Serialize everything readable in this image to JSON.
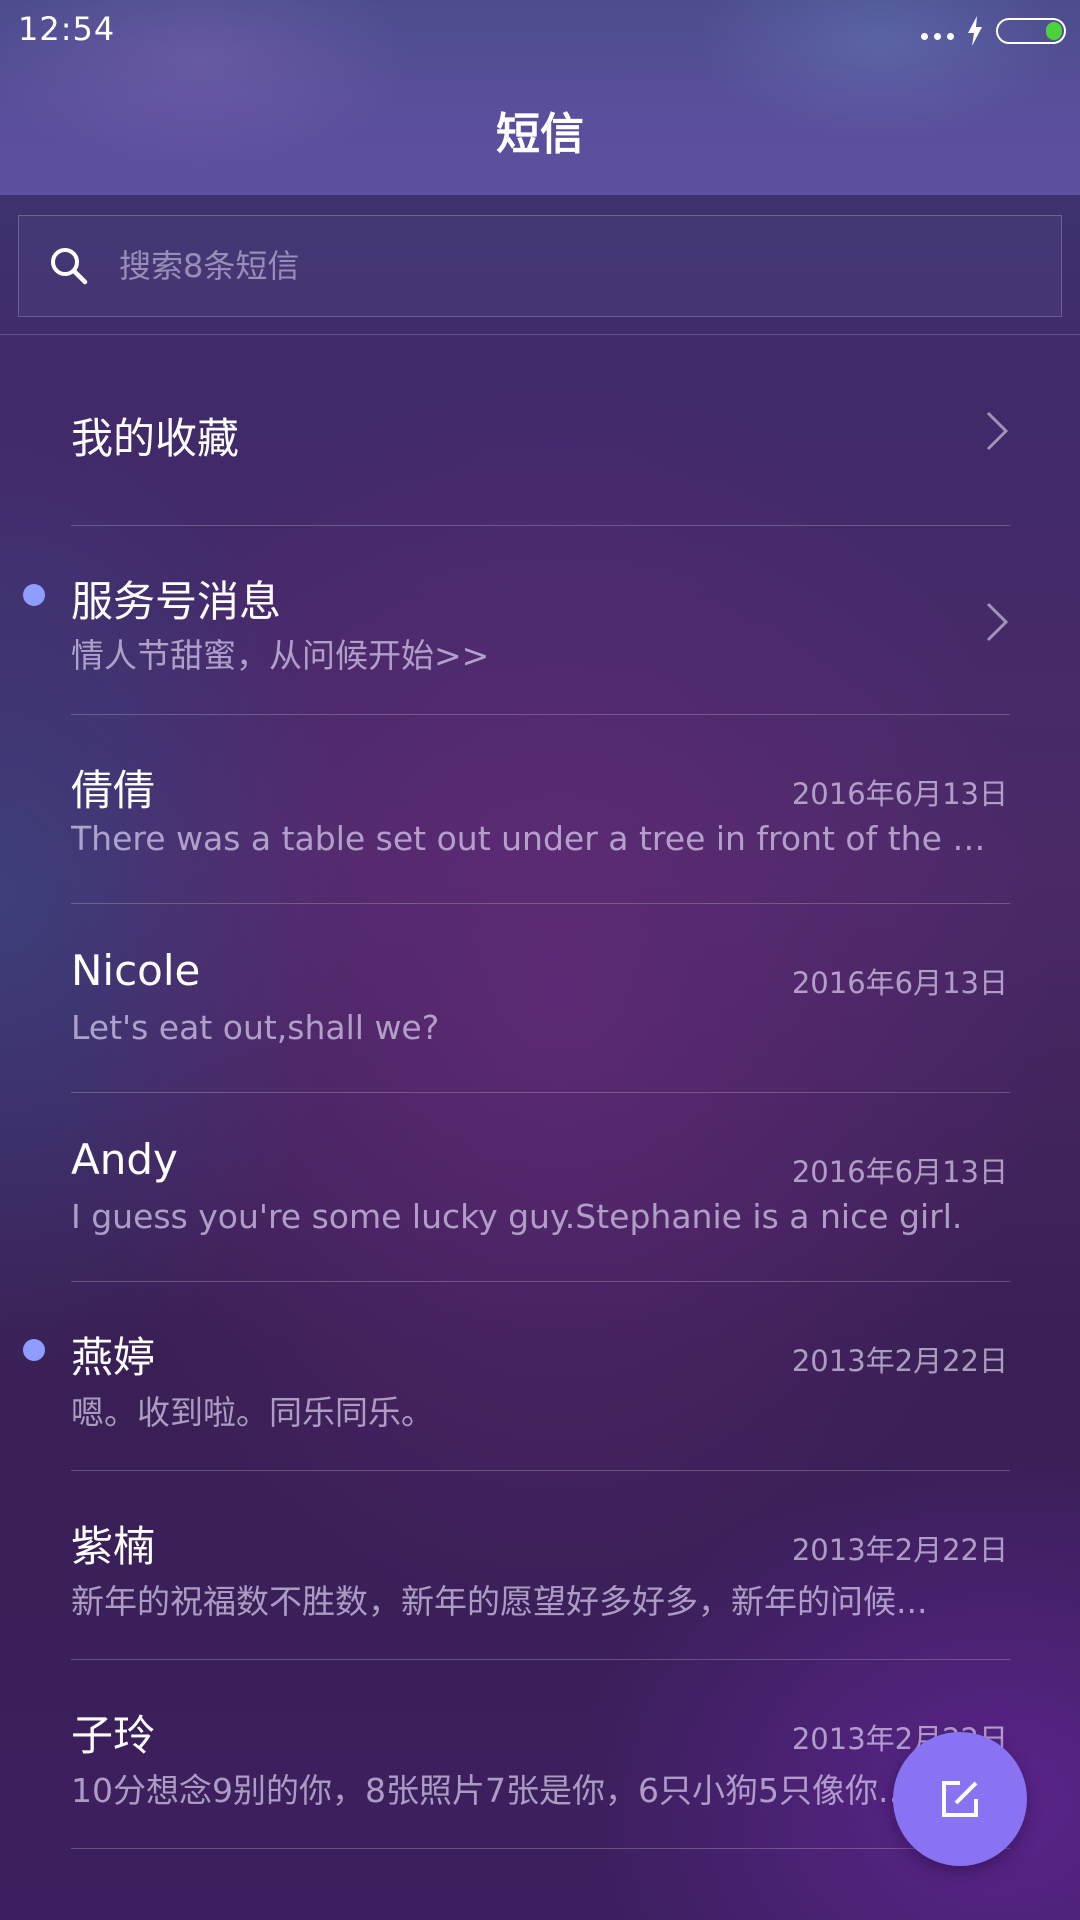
{
  "status_bar": {
    "time": "12:54"
  },
  "header": {
    "title": "短信"
  },
  "search": {
    "placeholder": "搜索8条短信"
  },
  "favorites": {
    "label": "我的收藏"
  },
  "service": {
    "title": "服务号消息",
    "preview": "情人节甜蜜，从问候开始>>",
    "unread": true
  },
  "conversations": [
    {
      "name": "倩倩",
      "date": "2016年6月13日",
      "preview": "There was a table set out under a tree in front of the ho...",
      "unread": false
    },
    {
      "name": "Nicole",
      "date": "2016年6月13日",
      "preview": "Let's eat out,shall we?",
      "unread": false
    },
    {
      "name": "Andy",
      "date": "2016年6月13日",
      "preview": "I guess you're some lucky guy.Stephanie is a nice girl.",
      "unread": false
    },
    {
      "name": "燕婷",
      "date": "2013年2月22日",
      "preview": "嗯。收到啦。同乐同乐。",
      "unread": true
    },
    {
      "name": "紫楠",
      "date": "2013年2月22日",
      "preview": "新年的祝福数不胜数，新年的愿望好多好多，新年的问候...",
      "unread": false
    },
    {
      "name": "子玲",
      "date": "2013年2月22日",
      "preview": "10分想念9别的你，8张照片7张是你，6只小狗5只像你...",
      "unread": false
    }
  ],
  "colors": {
    "unread_dot": "#8f9dff",
    "fab": "#8a73f2",
    "battery_fill": "#4cd23a"
  },
  "icons": {
    "search": "search-icon",
    "chevron": "chevron-right-icon",
    "compose": "compose-icon",
    "charging": "lightning-icon",
    "battery": "battery-icon",
    "more": "more-dots-icon"
  }
}
